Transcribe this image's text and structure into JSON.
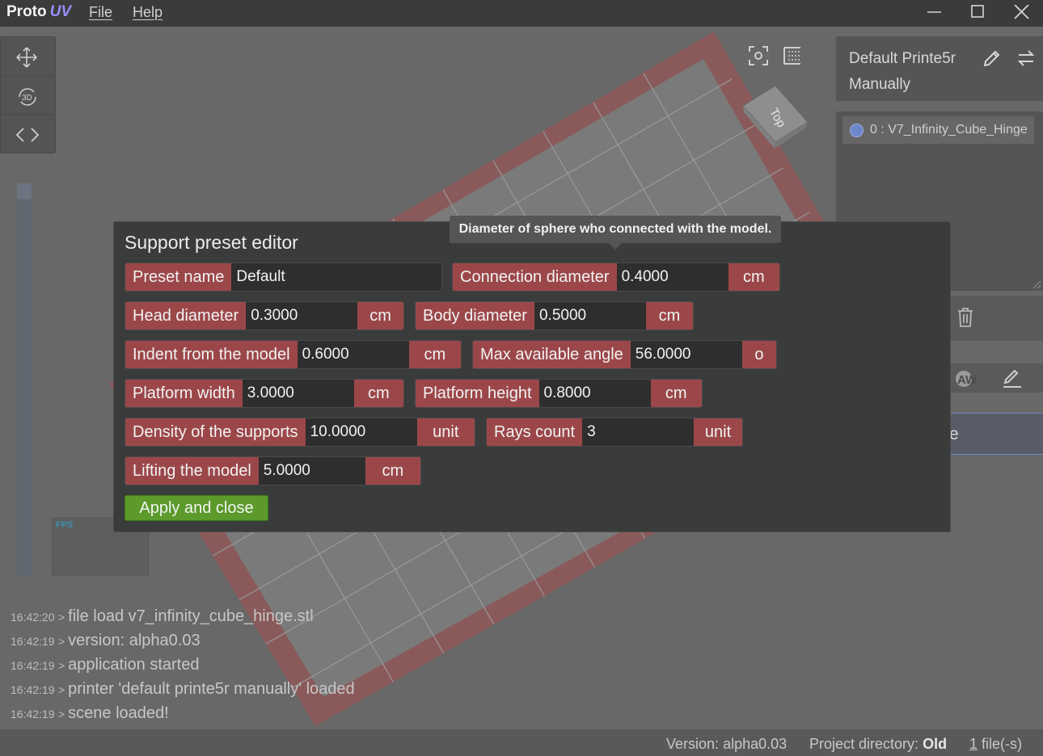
{
  "app": {
    "logo_text": "Proto",
    "logo_accent": "UV",
    "accent_color": "#9a8cff"
  },
  "menu": {
    "file": "File",
    "help": "Help"
  },
  "window_controls": [
    "minimize-icon",
    "maximize-icon",
    "close-icon"
  ],
  "toolbar": {
    "tools": [
      "move-icon",
      "rotate-3d-icon",
      "code-icon"
    ],
    "rotate_label": "3D"
  },
  "view": {
    "cube_label": "Top",
    "fps_label": "FPS"
  },
  "printer": {
    "name": "Default Printe5r Manually"
  },
  "models": [
    {
      "label": "0 : V7_Infinity_Cube_Hinge"
    }
  ],
  "right_panel": {
    "aw_label": "AW",
    "tab_label_fragment": "e"
  },
  "dialog": {
    "title": "Support preset editor",
    "tooltip": "Diameter of sphere who connected with the model.",
    "preset_name": {
      "label": "Preset name",
      "value": "Default"
    },
    "connection_diameter": {
      "label": "Connection diameter",
      "value": "0.4000",
      "unit": "cm"
    },
    "head_diameter": {
      "label": "Head diameter",
      "value": "0.3000",
      "unit": "cm"
    },
    "body_diameter": {
      "label": "Body diameter",
      "value": "0.5000",
      "unit": "cm"
    },
    "indent": {
      "label": "Indent from the model",
      "value": "0.6000",
      "unit": "cm"
    },
    "max_angle": {
      "label": "Max available angle",
      "value": "56.0000",
      "unit": "o"
    },
    "platform_width": {
      "label": "Platform width",
      "value": "3.0000",
      "unit": "cm"
    },
    "platform_height": {
      "label": "Platform height",
      "value": "0.8000",
      "unit": "cm"
    },
    "density": {
      "label": "Density of the supports",
      "value": "10.0000",
      "unit": "unit"
    },
    "rays_count": {
      "label": "Rays count",
      "value": "3",
      "unit": "unit"
    },
    "lifting": {
      "label": "Lifting the model",
      "value": "5.0000",
      "unit": "cm"
    },
    "apply_label": "Apply and close",
    "label_color": "#9b4749",
    "apply_color": "#5b9a2b"
  },
  "log": [
    {
      "time": "16:42:20",
      "message": "file load v7_infinity_cube_hinge.stl"
    },
    {
      "time": "16:42:19",
      "message": "version: alpha0.03"
    },
    {
      "time": "16:42:19",
      "message": "application started"
    },
    {
      "time": "16:42:19",
      "message": "printer 'default printe5r manually' loaded"
    },
    {
      "time": "16:42:19",
      "message": "scene loaded!"
    }
  ],
  "log_separator": ">",
  "status": {
    "version_label": "Version:",
    "version_value": "alpha0.03",
    "project_label": "Project directory:",
    "project_value": "Old",
    "files_count": "1",
    "files_label": "file(-s)"
  }
}
